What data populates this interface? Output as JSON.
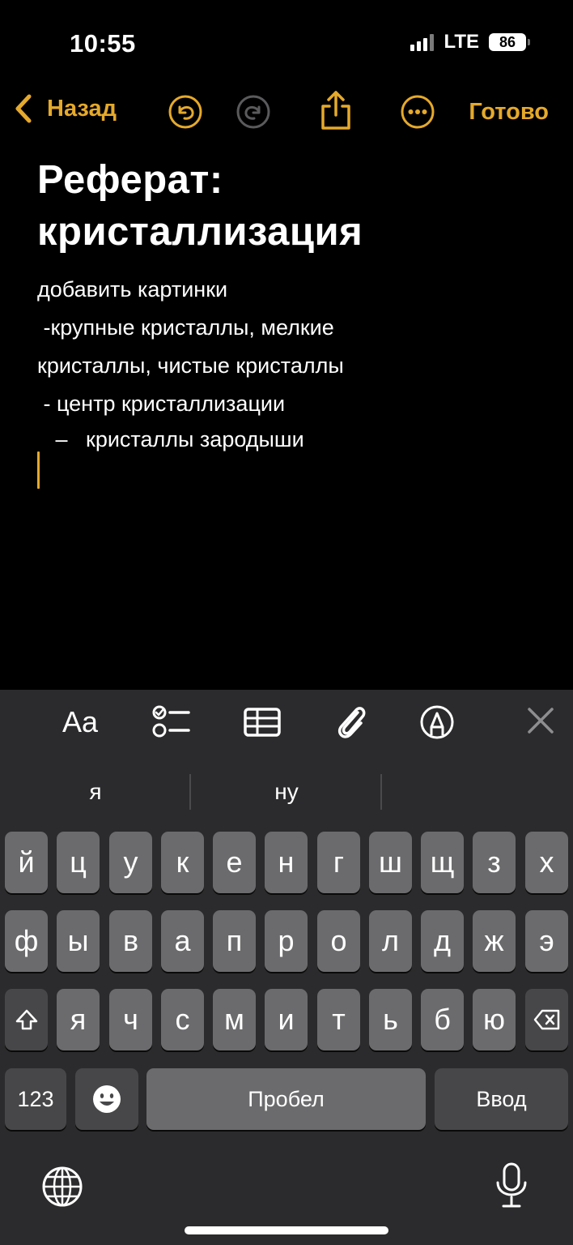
{
  "status": {
    "time": "10:55",
    "network": "LTE",
    "battery": "86"
  },
  "nav": {
    "back_label": "Назад",
    "done_label": "Готово",
    "accent": "#e5a92b"
  },
  "note": {
    "title_line1": "Реферат:",
    "title_line2": "кристаллизация",
    "lines": [
      "добавить картинки",
      " -крупные кристаллы, мелкие",
      "кристаллы, чистые кристаллы",
      " - центр кристаллизации",
      "   –   кристаллы зародыши"
    ]
  },
  "toolbar": {
    "format_label": "Aa"
  },
  "keyboard": {
    "suggestions": [
      "я",
      "ну",
      ""
    ],
    "row1": [
      "й",
      "ц",
      "у",
      "к",
      "е",
      "н",
      "г",
      "ш",
      "щ",
      "з",
      "х"
    ],
    "row2": [
      "ф",
      "ы",
      "в",
      "а",
      "п",
      "р",
      "о",
      "л",
      "д",
      "ж",
      "э"
    ],
    "row3": [
      "я",
      "ч",
      "с",
      "м",
      "и",
      "т",
      "ь",
      "б",
      "ю"
    ],
    "numbers_label": "123",
    "space_label": "Пробел",
    "return_label": "Ввод"
  }
}
